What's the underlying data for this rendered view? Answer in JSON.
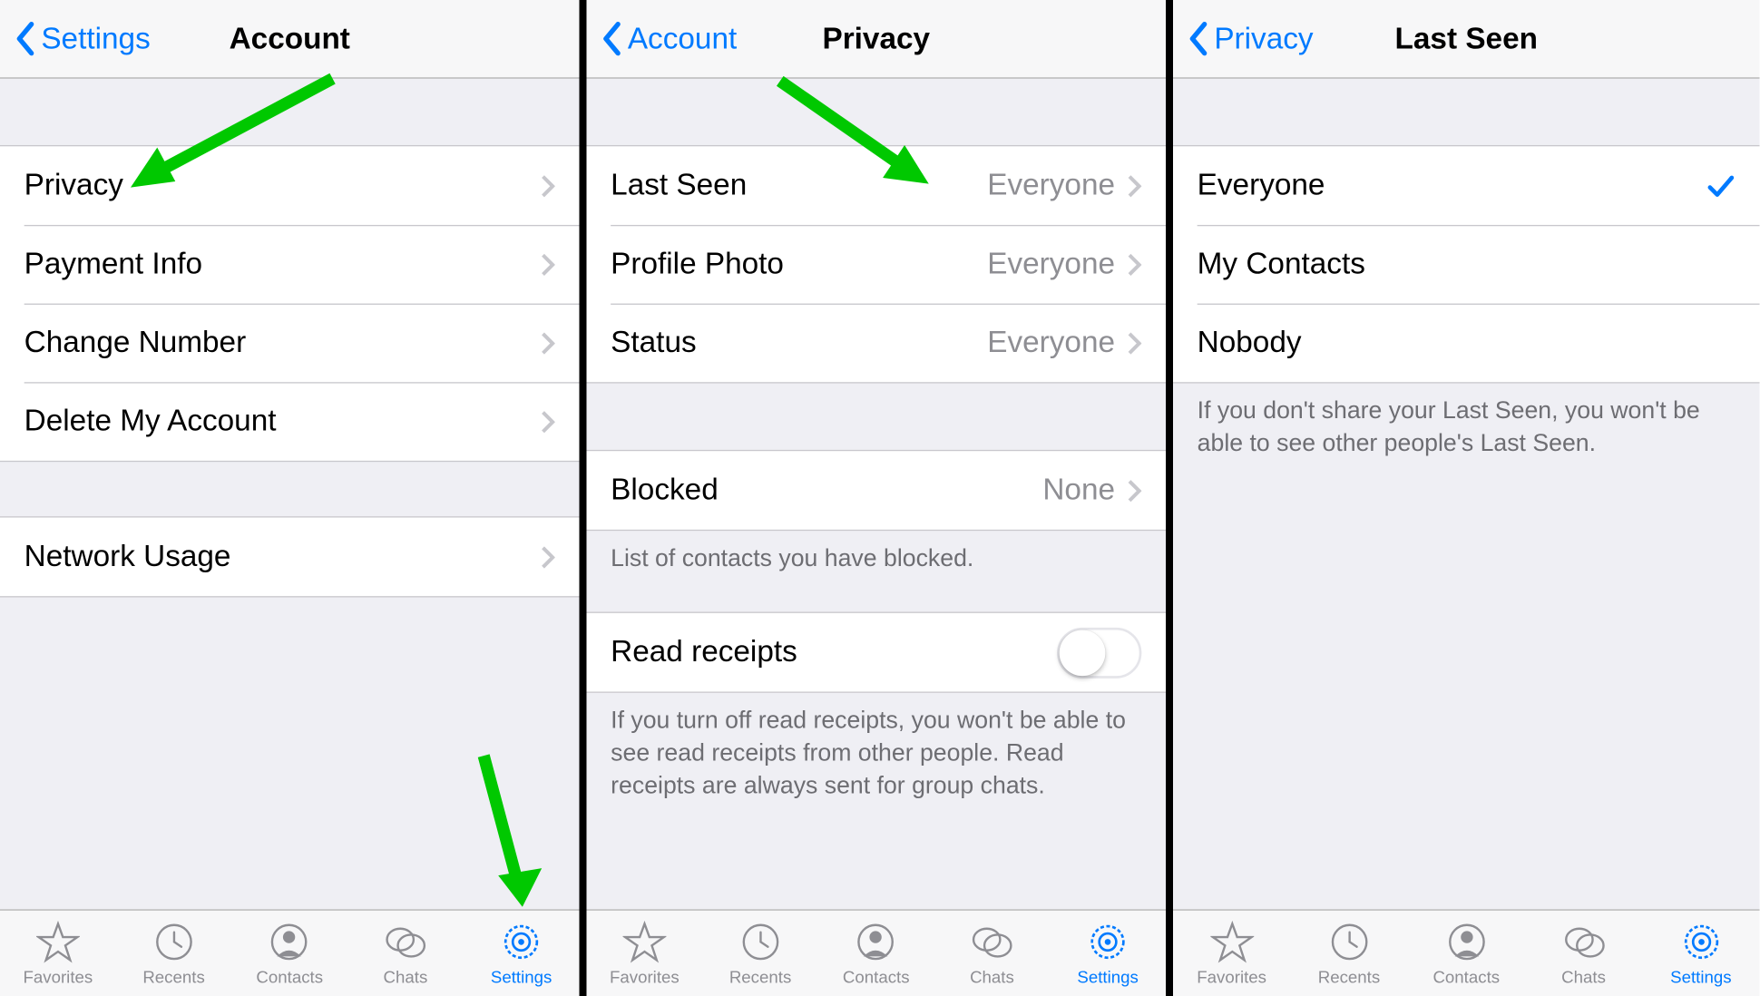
{
  "colors": {
    "accent": "#007aff",
    "arrow": "#00c800"
  },
  "tabs": {
    "favorites": "Favorites",
    "recents": "Recents",
    "contacts": "Contacts",
    "chats": "Chats",
    "settings": "Settings"
  },
  "panels": [
    {
      "back": "Settings",
      "title": "Account",
      "group1": [
        {
          "label": "Privacy"
        },
        {
          "label": "Payment Info"
        },
        {
          "label": "Change Number"
        },
        {
          "label": "Delete My Account"
        }
      ],
      "group2": [
        {
          "label": "Network Usage"
        }
      ]
    },
    {
      "back": "Account",
      "title": "Privacy",
      "visibility": [
        {
          "label": "Last Seen",
          "value": "Everyone"
        },
        {
          "label": "Profile Photo",
          "value": "Everyone"
        },
        {
          "label": "Status",
          "value": "Everyone"
        }
      ],
      "blocked": {
        "label": "Blocked",
        "value": "None"
      },
      "blocked_footer": "List of contacts you have blocked.",
      "read_receipts": {
        "label": "Read receipts",
        "on": false
      },
      "read_receipts_footer": "If you turn off read receipts, you won't be able to see read receipts from other people. Read receipts are always sent for group chats."
    },
    {
      "back": "Privacy",
      "title": "Last Seen",
      "options": [
        {
          "label": "Everyone",
          "checked": true
        },
        {
          "label": "My Contacts",
          "checked": false
        },
        {
          "label": "Nobody",
          "checked": false
        }
      ],
      "footer": "If you don't share your Last Seen, you won't be able to see other people's Last Seen."
    }
  ]
}
